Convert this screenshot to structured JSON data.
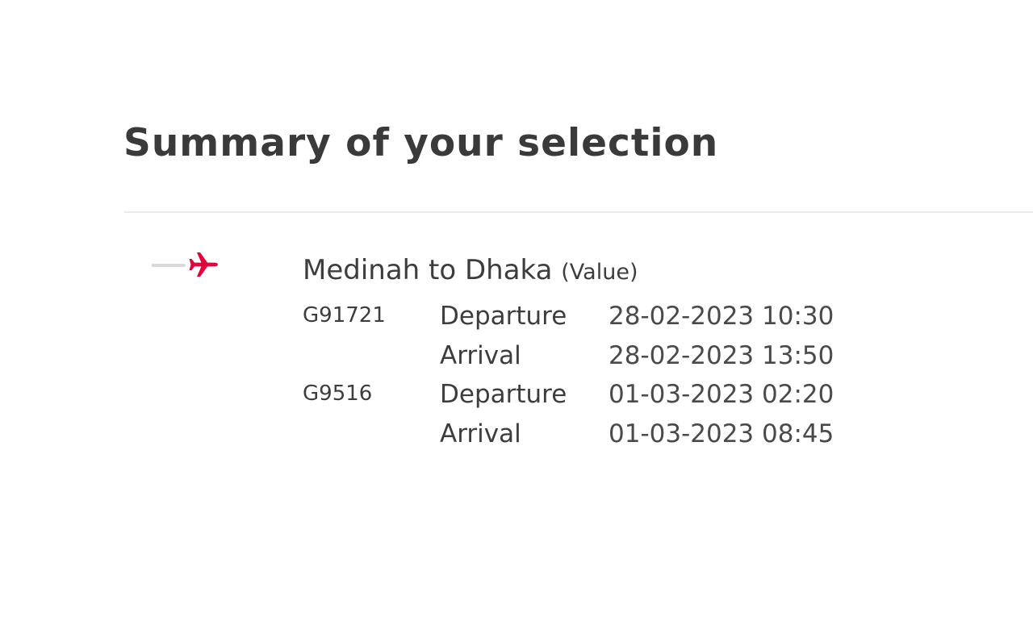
{
  "summary": {
    "title": "Summary of your selection"
  },
  "journey": {
    "icon": "plane-icon",
    "accent_color": "#e3003f",
    "line_color": "#d9d9d9",
    "route": "Medinah to Dhaka",
    "fare": "(Value)",
    "legs": [
      {
        "flight_number": "G91721",
        "events": [
          {
            "label": "Departure",
            "datetime": "28-02-2023 10:30"
          },
          {
            "label": "Arrival",
            "datetime": "28-02-2023 13:50"
          }
        ]
      },
      {
        "flight_number": "G9516",
        "events": [
          {
            "label": "Departure",
            "datetime": "01-03-2023 02:20"
          },
          {
            "label": "Arrival",
            "datetime": "01-03-2023 08:45"
          }
        ]
      }
    ]
  }
}
